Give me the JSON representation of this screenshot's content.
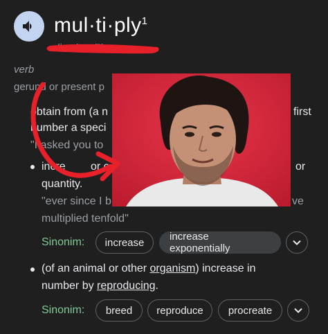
{
  "header": {
    "word": "mul·ti·ply",
    "superscript": "1",
    "pronunciation": "/ˈməltəˌplī/",
    "speaker_icon": "speaker-icon"
  },
  "entry": {
    "part_of_speech": "verb",
    "form_label": "gerund or present p"
  },
  "sense1": {
    "line1": "obtain from (a n",
    "line1_right": "first",
    "line2": "number a speci",
    "example": "\"I asked you to"
  },
  "sense2": {
    "line1_left": "incre",
    "line1_mid": "or c",
    "line1_right": "or",
    "line2": "quantity.",
    "example_line1_left": "\"ever since I b",
    "example_line1_right": "ve",
    "example_line2": "multiplied tenfold\"",
    "synonyms_label": "Sinonim:",
    "synonyms": [
      "increase",
      "increase exponentially"
    ]
  },
  "sense3": {
    "text_part1": "(of an animal or other ",
    "text_link1": "organism",
    "text_part2": ") increase in",
    "text_part3": "number by ",
    "text_link2": "reproducing",
    "text_part4": ".",
    "synonyms_label": "Sinonim:",
    "synonyms": [
      "breed",
      "reproduce",
      "procreate"
    ]
  },
  "colors": {
    "background": "#1f1f1f",
    "synonym_label": "#81c995",
    "annotation_red": "#e8202a",
    "speaker_bg": "#c2d4f0"
  }
}
